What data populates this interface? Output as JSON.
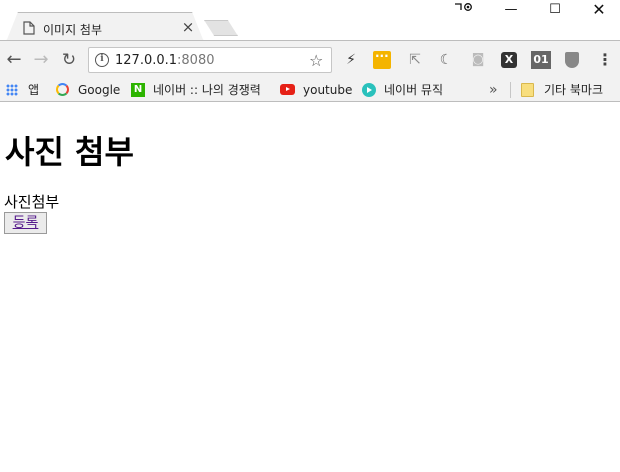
{
  "window": {
    "tab_title": "이미지 첨부",
    "tab_close": "×",
    "controls": {
      "minimize": "—",
      "maximize": "☐",
      "close": "✕"
    }
  },
  "toolbar": {
    "back": "←",
    "forward": "→",
    "reload": "↻",
    "url_host": "127.0.0.1",
    "url_port": ":8080",
    "ext_01_label": "01",
    "ext_x_label": "X",
    "menu": "⋮"
  },
  "bookmarks": {
    "items": [
      {
        "label": "앱",
        "icon": "apps-grid-icon"
      },
      {
        "label": "Google",
        "icon": "google-icon"
      },
      {
        "label": "네이버 :: 나의 경쟁력",
        "icon": "naver-icon"
      },
      {
        "label": "youtube",
        "icon": "youtube-icon"
      },
      {
        "label": "네이버 뮤직",
        "icon": "naver-music-icon"
      }
    ],
    "more": "»",
    "other_label": "기타 북마크"
  },
  "page": {
    "heading": "사진 첨부",
    "photo_label": "사진첨부",
    "submit_label": "등록"
  },
  "colors": {
    "chrome_bg": "#f2f2f2",
    "link_visited": "#551a8b",
    "naver_green": "#2db400",
    "youtube_red": "#e62117"
  }
}
